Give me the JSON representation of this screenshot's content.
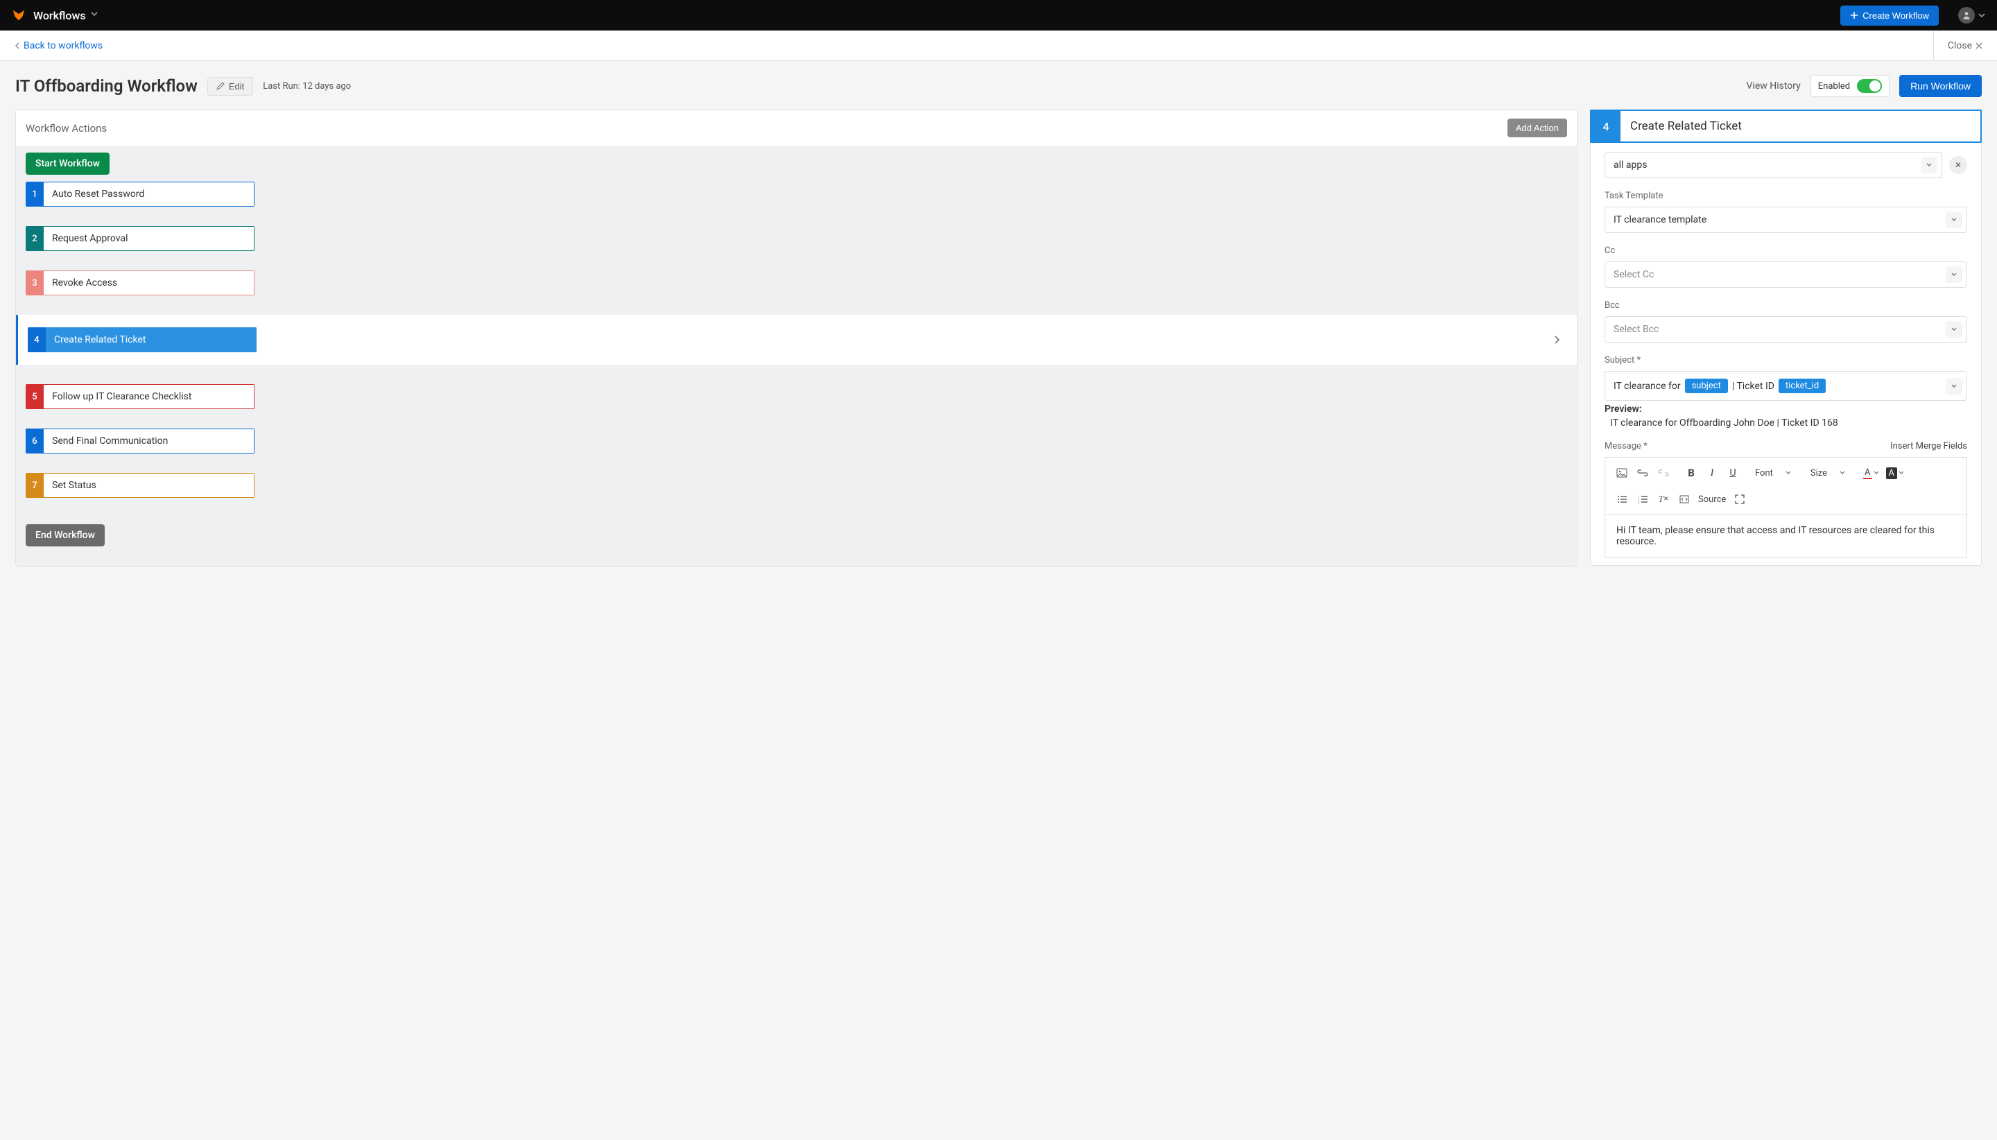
{
  "topbar": {
    "title": "Workflows",
    "create_btn": "Create Workflow"
  },
  "secbar": {
    "back": "Back to workflows",
    "close": "Close"
  },
  "page": {
    "title": "IT Offboarding Workflow",
    "edit": "Edit",
    "last_run": "Last Run: 12 days ago",
    "view_history": "View History",
    "enabled_label": "Enabled",
    "run": "Run Workflow"
  },
  "left": {
    "title": "Workflow Actions",
    "add_action": "Add Action",
    "start": "Start Workflow",
    "end": "End Workflow",
    "actions": [
      {
        "num": "1",
        "label": "Auto Reset Password"
      },
      {
        "num": "2",
        "label": "Request Approval"
      },
      {
        "num": "3",
        "label": "Revoke Access"
      },
      {
        "num": "4",
        "label": "Create Related Ticket"
      },
      {
        "num": "5",
        "label": "Follow up IT Clearance Checklist"
      },
      {
        "num": "6",
        "label": "Send Final Communication"
      },
      {
        "num": "7",
        "label": "Set Status"
      }
    ]
  },
  "right": {
    "num": "4",
    "title": "Create Related Ticket",
    "all_apps": "all apps",
    "task_template_label": "Task Template",
    "task_template_value": "IT clearance template",
    "cc_label": "Cc",
    "cc_placeholder": "Select Cc",
    "bcc_label": "Bcc",
    "bcc_placeholder": "Select Bcc",
    "subject_label": "Subject *",
    "subject_prefix": "IT clearance for",
    "subject_chip1": "subject",
    "subject_mid": "| Ticket ID",
    "subject_chip2": "ticket_id",
    "preview_label": "Preview:",
    "preview_text": "IT clearance for Offboarding John Doe | Ticket ID 168",
    "message_label": "Message *",
    "merge_fields": "Insert Merge Fields",
    "message_body": "Hi IT team, please ensure that access and IT resources are cleared for this resource.",
    "tb_font": "Font",
    "tb_size": "Size",
    "tb_source": "Source"
  }
}
